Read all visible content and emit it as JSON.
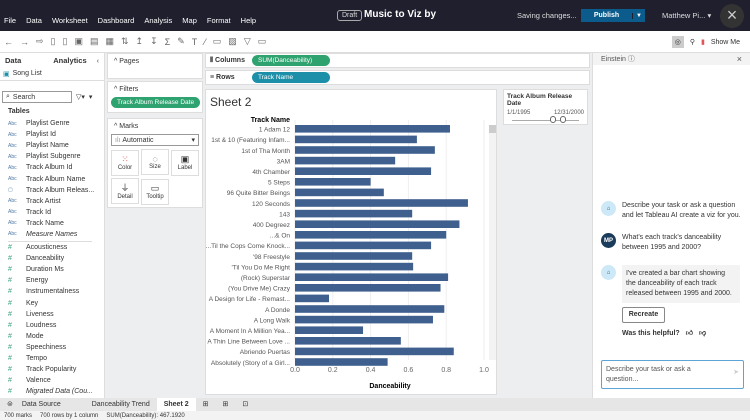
{
  "menu": [
    "File",
    "Data",
    "Worksheet",
    "Dashboard",
    "Analysis",
    "Map",
    "Format",
    "Help"
  ],
  "header": {
    "draft": "Draft",
    "title": "Music to Viz by",
    "saving": "Saving changes...",
    "publish": "Publish",
    "user": "Matthew Pi...",
    "show_me": "Show Me"
  },
  "data_pane": {
    "tabs": [
      "Data",
      "Analytics"
    ],
    "source": "Song List",
    "search_placeholder": "Search",
    "tables_label": "Tables",
    "dimensions": [
      "Playlist Genre",
      "Playlist Id",
      "Playlist Name",
      "Playlist Subgenre",
      "Track Album Id",
      "Track Album Name",
      "Track Album Releas...",
      "Track Artist",
      "Track Id",
      "Track Name",
      "Measure Names"
    ],
    "measures": [
      "Acousticness",
      "Danceability",
      "Duration Ms",
      "Energy",
      "Instrumentalness",
      "Key",
      "Liveness",
      "Loudness",
      "Mode",
      "Speechiness",
      "Tempo",
      "Track Popularity",
      "Valence",
      "Migrated Data (Cou..."
    ]
  },
  "pages": {
    "label": "Pages"
  },
  "filters": {
    "label": "Filters",
    "pill": "Track Album Release Date"
  },
  "marks": {
    "label": "Marks",
    "type": "Automatic",
    "cards": [
      "Color",
      "Size",
      "Label",
      "Detail",
      "Tooltip"
    ]
  },
  "shelves": {
    "columns_label": "Columns",
    "columns_pill": "SUM(Danceability)",
    "rows_label": "Rows",
    "rows_pill": "Track Name"
  },
  "filter_card": {
    "title": "Track Album Release Date",
    "start": "1/1/1995",
    "end": "12/31/2000"
  },
  "sheet_title": "Sheet 2",
  "chart_data": {
    "type": "bar",
    "orientation": "horizontal",
    "row_header": "Track Name",
    "xlabel": "Danceability",
    "xlim": [
      0,
      1.0
    ],
    "xticks": [
      "0.0",
      "0.2",
      "0.4",
      "0.6",
      "0.8",
      "1.0"
    ],
    "grid": true,
    "bar_color": "#3f5f8e",
    "categories": [
      "1 Adam 12",
      "1st & 10 (Featuring Infam...",
      "1st of Tha Month",
      "3AM",
      "4th Chamber",
      "5 Steps",
      "96 Quite Bitter Beings",
      "120 Seconds",
      "143",
      "400 Degreez",
      "...& On",
      "...Til the Cops Come Knock...",
      "'98 Freestyle",
      "'Til You Do Me Right",
      "(Rock) Superstar",
      "(You Drive Me) Crazy",
      "A Design for Life - Remast...",
      "A Donde",
      "A Long Walk",
      "A Moment In A Million Yea...",
      "A Thin Line Between Love ...",
      "Abriendo Puertas",
      "Absolutely (Story of a Girl..."
    ],
    "values": [
      0.82,
      0.645,
      0.74,
      0.53,
      0.72,
      0.4,
      0.47,
      0.915,
      0.62,
      0.87,
      0.8,
      0.72,
      0.62,
      0.625,
      0.81,
      0.77,
      0.18,
      0.79,
      0.73,
      0.36,
      0.56,
      0.84,
      0.49
    ]
  },
  "einstein": {
    "title": "Einstein",
    "messages": [
      {
        "from": "bot",
        "text": "Describe your task or ask a question and let Tableau AI create a viz for you."
      },
      {
        "from": "user",
        "avatar": "MP",
        "text": "What's each track's danceability between 1995 and 2000?"
      },
      {
        "from": "bot",
        "text": "I've created a bar chart showing the danceability of each track released between 1995 and 2000."
      }
    ],
    "recreate": "Recreate",
    "helpful": "Was this helpful?",
    "input_placeholder": "Describe your task or ask a question..."
  },
  "tabs": {
    "data_source": "Data Source",
    "sheets": [
      "Danceability Trend",
      "Sheet 2"
    ]
  },
  "status": {
    "marks": "700 marks",
    "rows": "700 rows by 1 column",
    "sum": "SUM(Danceability): 467.1920"
  }
}
